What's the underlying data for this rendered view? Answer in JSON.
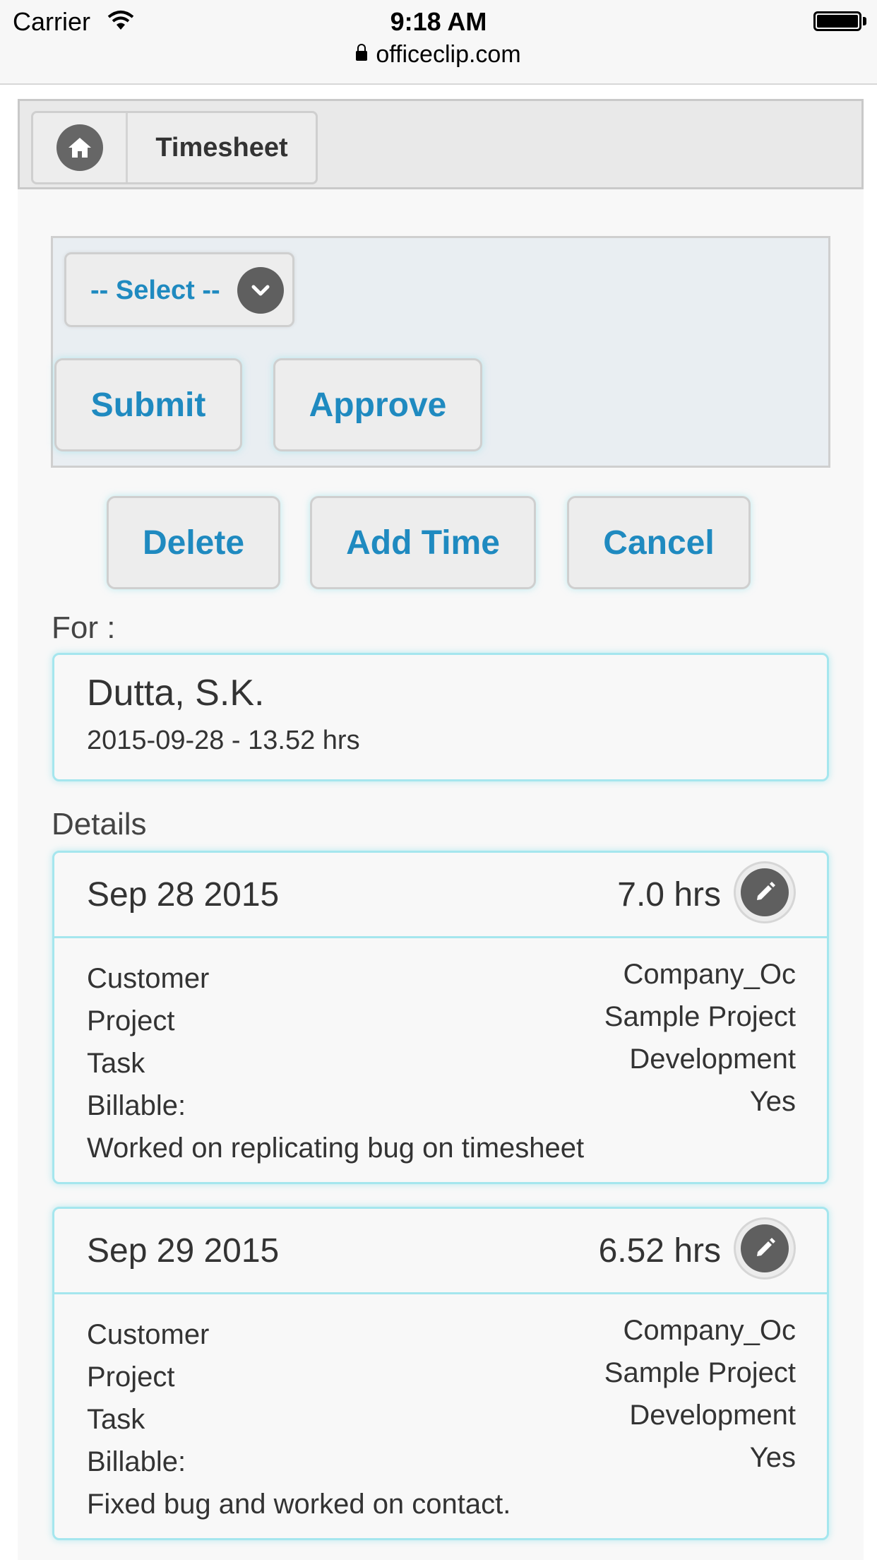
{
  "status_bar": {
    "carrier": "Carrier",
    "time": "9:18 AM",
    "url": "officeclip.com"
  },
  "header": {
    "breadcrumb": "Timesheet"
  },
  "actions": {
    "select_label": "-- Select --",
    "submit": "Submit",
    "approve": "Approve",
    "delete": "Delete",
    "add_time": "Add Time",
    "cancel": "Cancel"
  },
  "for_section": {
    "label": "For :",
    "name": "Dutta, S.K.",
    "summary": "2015-09-28 - 13.52 hrs"
  },
  "details": {
    "label": "Details",
    "field_labels": {
      "customer": "Customer",
      "project": "Project",
      "task": "Task",
      "billable": "Billable:"
    },
    "entries": [
      {
        "date": "Sep 28 2015",
        "hours": "7.0 hrs",
        "customer": "Company_Oc",
        "project": "Sample Project",
        "task": "Development",
        "billable": "Yes",
        "note": "Worked on replicating bug on timesheet"
      },
      {
        "date": "Sep 29 2015",
        "hours": "6.52 hrs",
        "customer": "Company_Oc",
        "project": "Sample Project",
        "task": "Development",
        "billable": "Yes",
        "note": "Fixed bug and worked on contact."
      }
    ]
  },
  "colors": {
    "accent": "#1f8ac0",
    "card_border": "#a5e6ee",
    "icon_bg": "#5f5f5f",
    "panel_bg": "#e9eef2"
  },
  "icons": {
    "home": "home-icon",
    "select": "chevron-down-icon",
    "edit": "pencil-icon",
    "wifi": "wifi-icon",
    "battery": "battery-icon",
    "lock": "lock-icon"
  }
}
